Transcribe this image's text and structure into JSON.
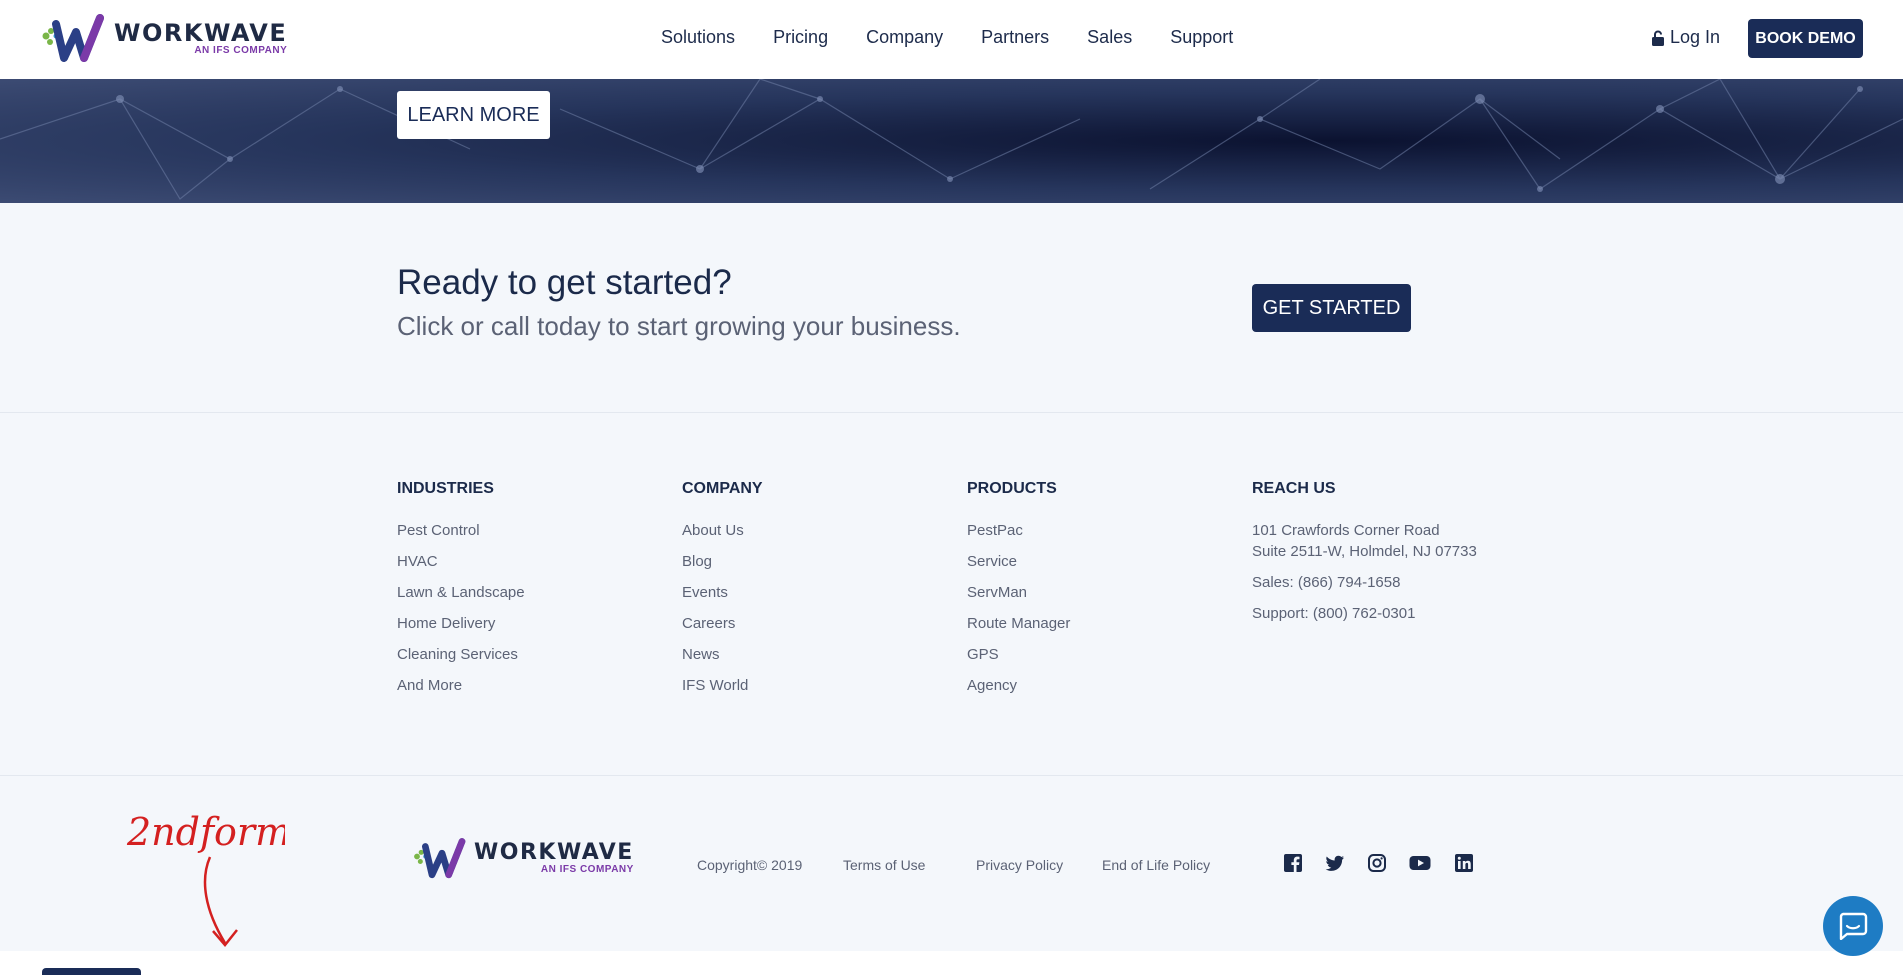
{
  "header": {
    "logo": {
      "word": "WORKWAVE",
      "sub": "AN IFS COMPANY"
    },
    "nav": [
      "Solutions",
      "Pricing",
      "Company",
      "Partners",
      "Sales",
      "Support"
    ],
    "login_label": "Log In",
    "cta_label": "BOOK DEMO"
  },
  "hero": {
    "button_label": "LEARN MORE"
  },
  "cta": {
    "heading": "Ready to get started?",
    "subheading": "Click or call today to start growing your business.",
    "button_label": "GET STARTED"
  },
  "footer": {
    "industries": {
      "title": "INDUSTRIES",
      "links": [
        "Pest Control",
        "HVAC",
        "Lawn & Landscape",
        "Home Delivery",
        "Cleaning Services",
        "And More"
      ]
    },
    "company": {
      "title": "COMPANY",
      "links": [
        "About Us",
        "Blog",
        "Events",
        "Careers",
        "News",
        "IFS World"
      ]
    },
    "products": {
      "title": "PRODUCTS",
      "links": [
        "PestPac",
        "Service",
        "ServMan",
        "Route Manager",
        "GPS",
        "Agency"
      ]
    },
    "reach": {
      "title": "REACH US",
      "address_line1": "101 Crawfords Corner Road",
      "address_line2": "Suite 2511-W, Holmdel, NJ 07733",
      "sales": "Sales: (866) 794-1658",
      "support": "Support: (800) 762-0301"
    }
  },
  "bottom": {
    "logo": {
      "word": "WORKWAVE",
      "sub": "AN IFS COMPANY"
    },
    "copyright": "Copyright© 2019",
    "legal": [
      "Terms of Use",
      "Privacy Policy",
      "End of Life Policy"
    ],
    "social": [
      "facebook-icon",
      "twitter-icon",
      "instagram-icon",
      "youtube-icon",
      "linkedin-icon"
    ],
    "annotation": "2ndform"
  },
  "colors": {
    "navy": "#1a2c57",
    "text": "#5b6275",
    "bg": "#f4f7fb",
    "chat": "#1e7cc4",
    "annotation": "#d42020"
  }
}
